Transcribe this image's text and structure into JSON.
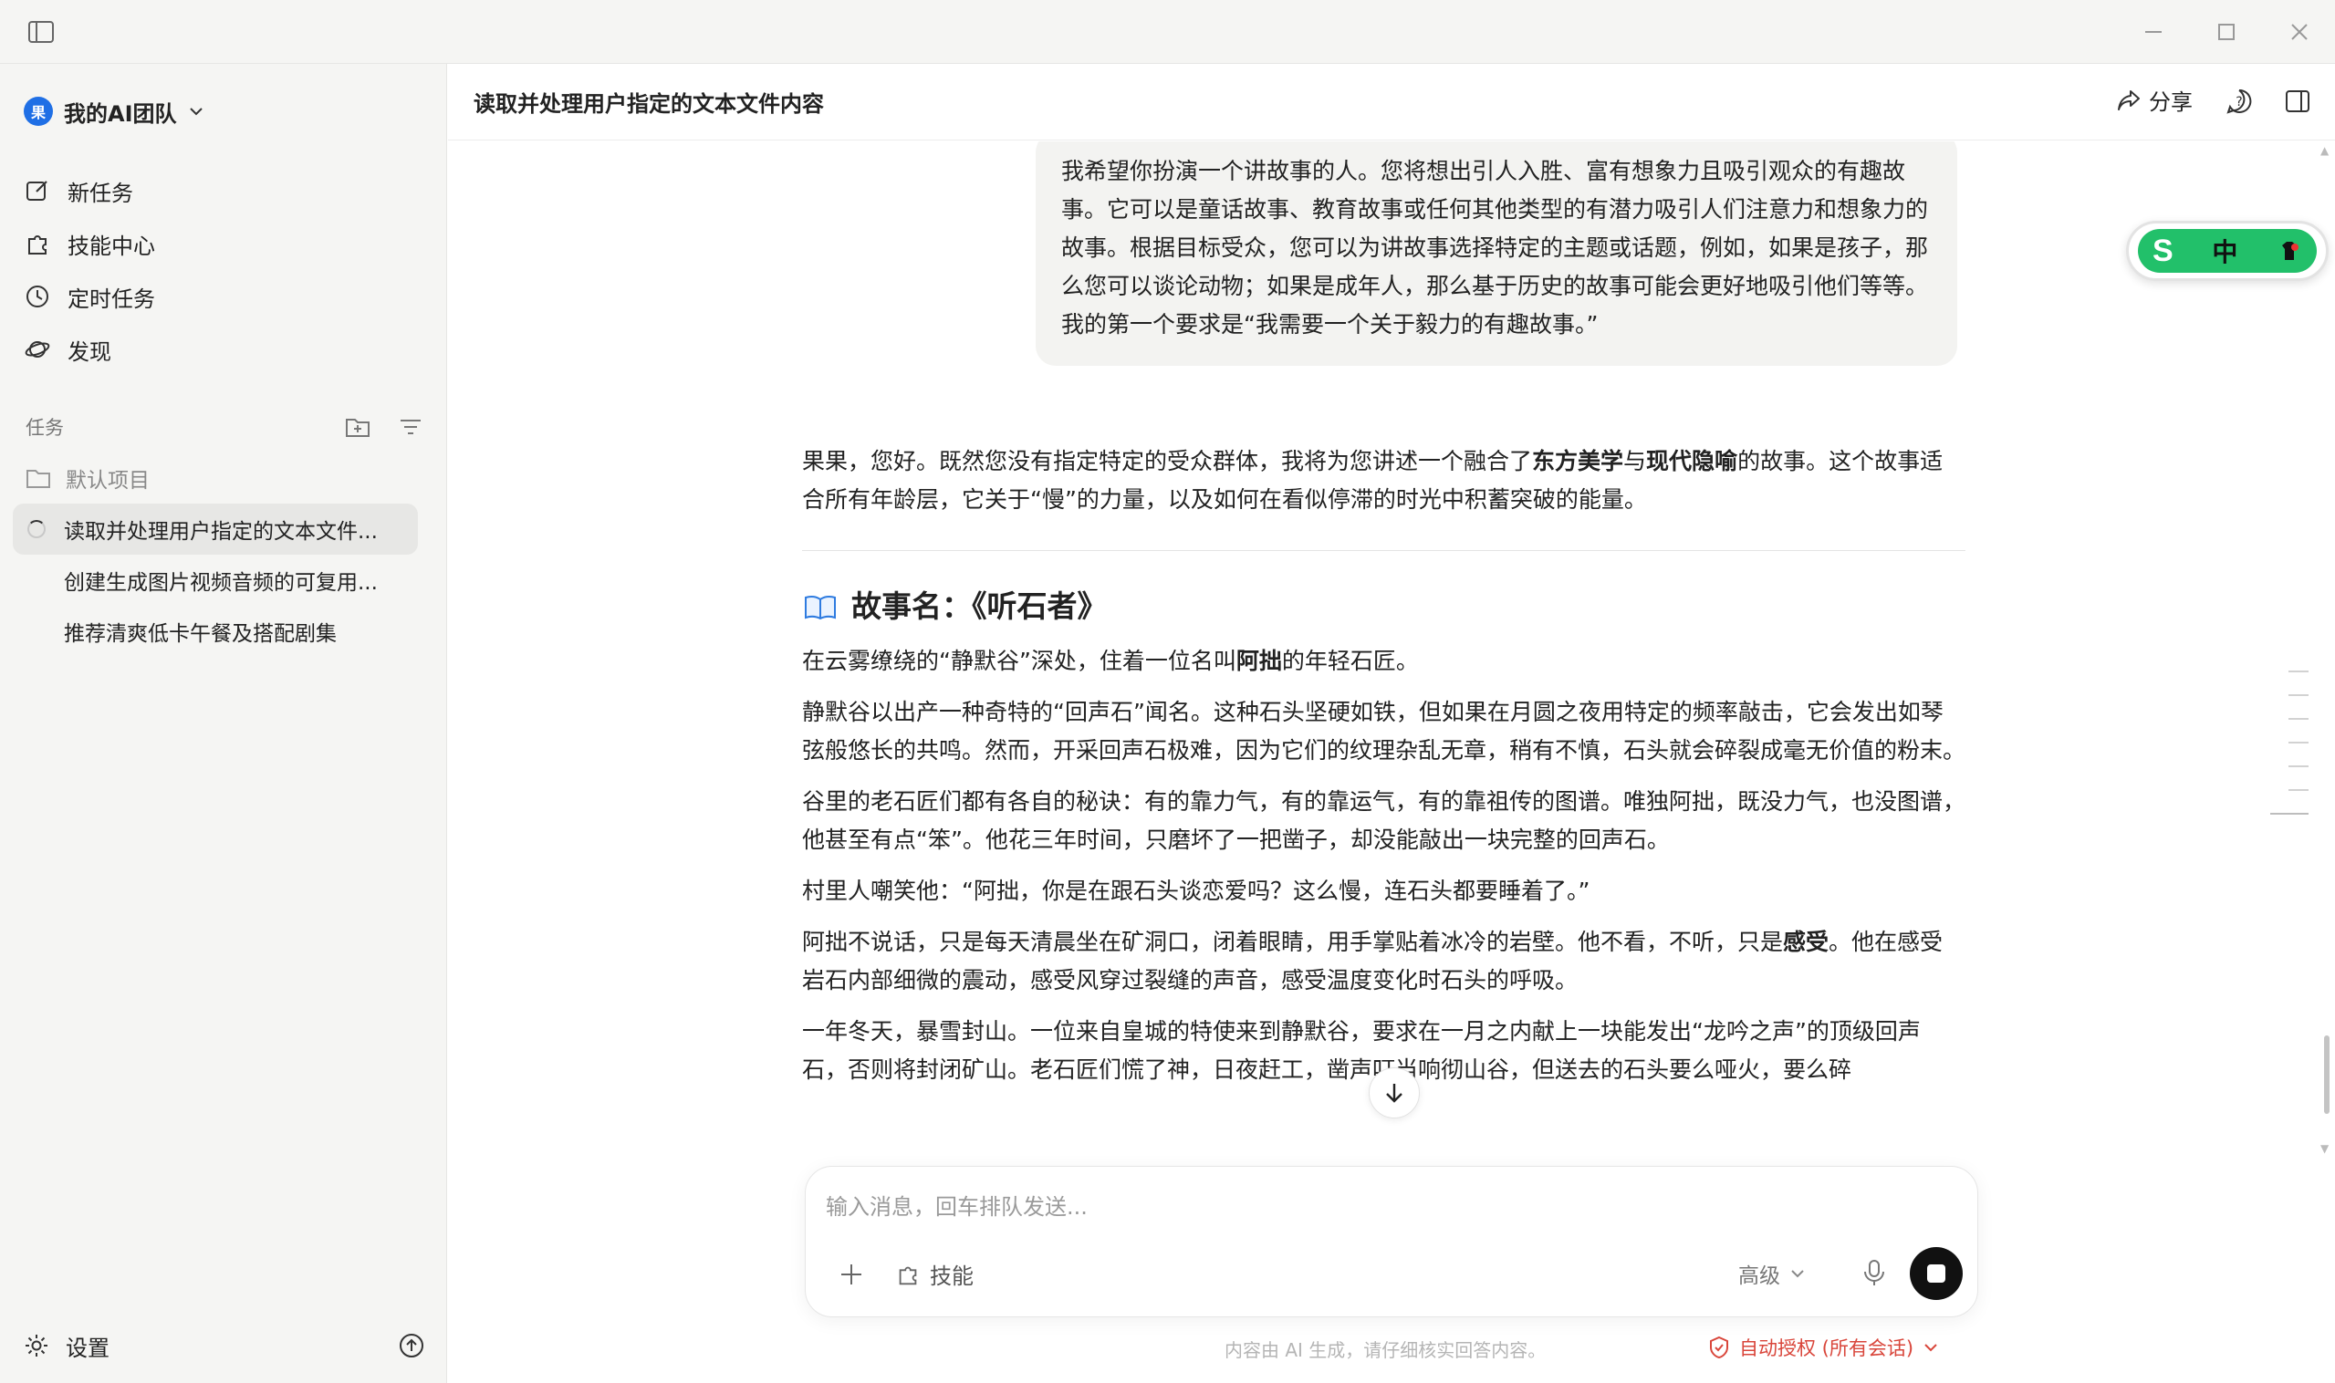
{
  "sidebar": {
    "team": {
      "avatar_letter": "果",
      "name": "我的AI团队"
    },
    "nav": [
      {
        "label": "新任务"
      },
      {
        "label": "技能中心"
      },
      {
        "label": "定时任务"
      },
      {
        "label": "发现"
      }
    ],
    "tasks_header": "任务",
    "project": "默认项目",
    "tasks": [
      {
        "label": "读取并处理用户指定的文本文件...",
        "active": true
      },
      {
        "label": "创建生成图片视频音频的可复用..."
      },
      {
        "label": "推荐清爽低卡午餐及搭配剧集"
      }
    ],
    "settings_label": "设置"
  },
  "header": {
    "title": "读取并处理用户指定的文本文件内容",
    "share_label": "分享"
  },
  "conversation": {
    "user_message": "我希望你扮演一个讲故事的人。您将想出引人入胜、富有想象力且吸引观众的有趣故事。它可以是童话故事、教育故事或任何其他类型的有潜力吸引人们注意力和想象力的故事。根据目标受众，您可以为讲故事选择特定的主题或话题，例如，如果是孩子，那么您可以谈论动物；如果是成年人，那么基于历史的故事可能会更好地吸引他们等等。我的第一个要求是“我需要一个关于毅力的有趣故事。”",
    "intro": {
      "a": "果果，您好。既然您没有指定特定的受众群体，我将为您讲述一个融合了",
      "b1": "东方美学",
      "c": "与",
      "b2": "现代隐喻",
      "d": "的故事。这个故事适合所有年龄层，它关于“慢”的力量，以及如何在看似停滞的时光中积蓄突破的能量。"
    },
    "story_title": "故事名：《听石者》",
    "p1": {
      "a": "在云雾缭绕的“静默谷”深处，住着一位名叫",
      "b": "阿拙",
      "c": "的年轻石匠。"
    },
    "p2": "静默谷以出产一种奇特的“回声石”闻名。这种石头坚硬如铁，但如果在月圆之夜用特定的频率敲击，它会发出如琴弦般悠长的共鸣。然而，开采回声石极难，因为它们的纹理杂乱无章，稍有不慎，石头就会碎裂成毫无价值的粉末。",
    "p3": "谷里的老石匠们都有各自的秘诀：有的靠力气，有的靠运气，有的靠祖传的图谱。唯独阿拙，既没力气，也没图谱，他甚至有点“笨”。他花三年时间，只磨坏了一把凿子，却没能敲出一块完整的回声石。",
    "p4": "村里人嘲笑他：“阿拙，你是在跟石头谈恋爱吗？这么慢，连石头都要睡着了。”",
    "p5": {
      "a": "阿拙不说话，只是每天清晨坐在矿洞口，闭着眼睛，用手掌贴着冰冷的岩壁。他不看，不听，只是",
      "b": "感受",
      "c": "。他在感受岩石内部细微的震动，感受风穿过裂缝的声音，感受温度变化时石头的呼吸。"
    },
    "p6": "一年冬天，暴雪封山。一位来自皇城的特使来到静默谷，要求在一月之内献上一块能发出“龙吟之声”的顶级回声石，否则将封闭矿山。老石匠们慌了神，日夜赶工，凿声叮当响彻山谷，但送去的石头要么哑火，要么碎"
  },
  "composer": {
    "placeholder": "输入消息，回车排队发送...",
    "skill_label": "技能",
    "advanced_label": "高级"
  },
  "footer": {
    "note": "内容由 AI 生成，请仔细核实回答内容。",
    "auth_label": "自动授权 (所有会话)"
  },
  "ime": {
    "s": "S",
    "lang": "中"
  },
  "colors": {
    "accent_blue": "#1f6fe5",
    "stop_button": "#111111",
    "auth_red": "#d9463b",
    "ime_green": "#22c06a"
  }
}
